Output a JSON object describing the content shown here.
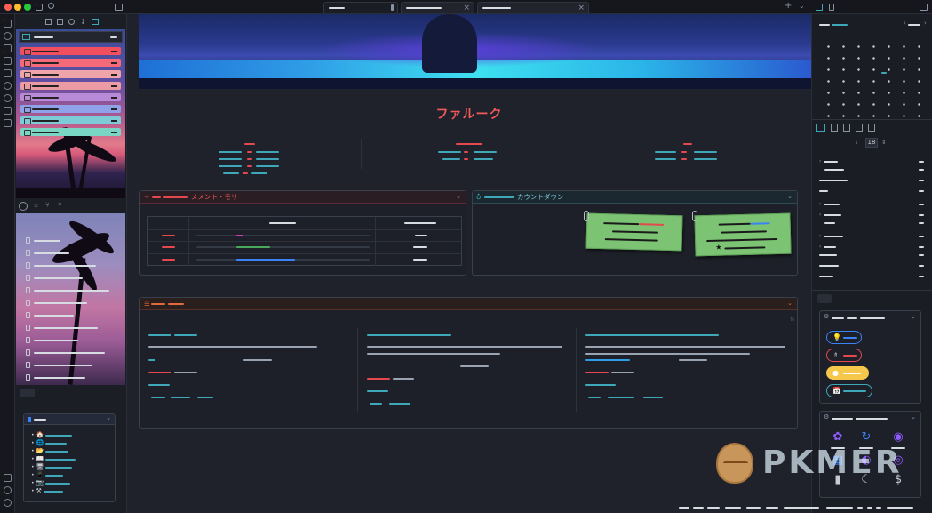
{
  "window": {
    "traffic_lights": [
      "#ff5f57",
      "#febc2e",
      "#28c840"
    ]
  },
  "main": {
    "title": "ファルーク",
    "memento_panel": {
      "title": "メメント・モリ",
      "accent": "#e5484d"
    },
    "countdown_panel": {
      "title": "カウントダウン",
      "accent": "#3ea8b8"
    }
  },
  "right": {
    "calendar_picker_value": "18"
  },
  "watermark": {
    "text": "PKMER"
  },
  "colors": {
    "accent_red": "#e5484d",
    "accent_teal": "#3ea8b8",
    "bg": "#1f222a",
    "note_green": "#7cc474",
    "pill_yellow": "#f5c84c"
  }
}
